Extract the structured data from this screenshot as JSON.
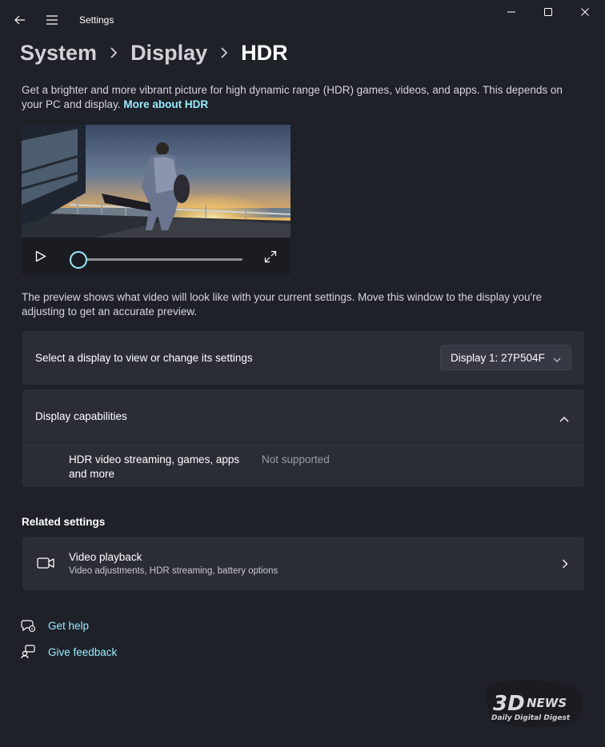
{
  "window": {
    "title": "Settings",
    "icons": {
      "back": "back-arrow-icon",
      "menu": "hamburger-menu-icon",
      "minimize": "minimize-icon",
      "maximize": "maximize-icon",
      "close": "close-icon"
    }
  },
  "breadcrumb": [
    "System",
    "Display",
    "HDR"
  ],
  "description": {
    "text": "Get a brighter and more vibrant picture for high dynamic range (HDR) games, videos, and apps. This depends on your PC and display.",
    "link": "More about HDR"
  },
  "video_preview": {
    "progress": 0,
    "icons": {
      "play": "play-icon",
      "fullscreen": "expand-icon"
    }
  },
  "preview_note": "The preview shows what video will look like with your current settings. Move this window to the display you're adjusting to get an accurate preview.",
  "display_select": {
    "label": "Select a display to view or change its settings",
    "value": "Display 1: 27P504F"
  },
  "capabilities": {
    "title": "Display capabilities",
    "expanded": true,
    "items": [
      {
        "label_line1": "HDR video streaming, games, apps",
        "label_line2": "and more",
        "status": "Not supported"
      }
    ]
  },
  "related": {
    "title": "Related settings",
    "items": [
      {
        "icon": "video-camera-icon",
        "title": "Video playback",
        "subtitle": "Video adjustments, HDR streaming, battery options"
      }
    ]
  },
  "links": [
    {
      "icon": "help-chat-icon",
      "label": "Get help"
    },
    {
      "icon": "feedback-icon",
      "label": "Give feedback"
    }
  ],
  "watermark": {
    "logo": "3DNEWS",
    "tagline": "Daily Digital Digest"
  },
  "colors": {
    "background": "#1f2129",
    "card": "#2b2d36",
    "accent": "#99ebff",
    "text_secondary": "#9a9ca3"
  }
}
